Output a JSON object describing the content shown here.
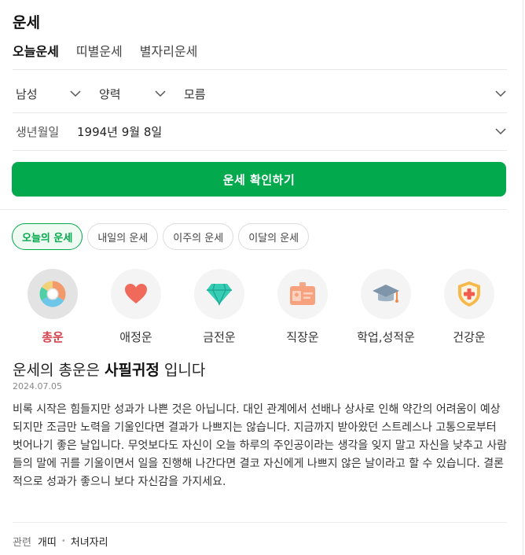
{
  "title": "운세",
  "tabs": [
    {
      "label": "오늘운세",
      "active": true
    },
    {
      "label": "띠별운세",
      "active": false
    },
    {
      "label": "별자리운세",
      "active": false
    }
  ],
  "form": {
    "gender": "남성",
    "calendar": "양력",
    "birth_time": "모름",
    "birth_label": "생년월일",
    "birth_value": "1994년 9월 8일"
  },
  "confirm_button": "운세 확인하기",
  "periods": [
    {
      "label": "오늘의 운세",
      "active": true
    },
    {
      "label": "내일의 운세",
      "active": false
    },
    {
      "label": "이주의 운세",
      "active": false
    },
    {
      "label": "이달의 운세",
      "active": false
    }
  ],
  "categories": [
    {
      "label": "총운",
      "icon": "donut-chart-icon",
      "active": true
    },
    {
      "label": "애정운",
      "icon": "heart-icon",
      "active": false
    },
    {
      "label": "금전운",
      "icon": "diamond-icon",
      "active": false
    },
    {
      "label": "직장운",
      "icon": "id-badge-icon",
      "active": false
    },
    {
      "label": "학업,성적운",
      "icon": "graduation-cap-icon",
      "active": false
    },
    {
      "label": "건강운",
      "icon": "health-shield-icon",
      "active": false
    }
  ],
  "result": {
    "headline_prefix": "운세의 총운은 ",
    "headline_keyword": "사필귀정",
    "headline_suffix": " 입니다",
    "date": "2024.07.05",
    "description": "비록 시작은 힘들지만 성과가 나쁜 것은 아닙니다. 대인 관계에서 선배나 상사로 인해 약간의 어려움이 예상되지만 조금만 노력을 기울인다면 결과가 나쁘지는 않습니다. 지금까지 받아왔던 스트레스나 고통으로부터 벗어나기 좋은 날입니다. 무엇보다도 자신이 오늘 하루의 주인공이라는 생각을 잊지 말고 자신을 낮추고 사람들의 말에 귀를 기울이면서 일을 진행해 나간다면 결코 자신에게 나쁘지 않은 날이라고 할 수 있습니다. 결론적으로 성과가 좋으니 보다 자신감을 가지세요."
  },
  "related": {
    "label": "관련",
    "links": [
      "개띠",
      "처녀자리"
    ]
  },
  "colors": {
    "accent_green": "#03a94d",
    "active_category_red": "#d8434e"
  }
}
